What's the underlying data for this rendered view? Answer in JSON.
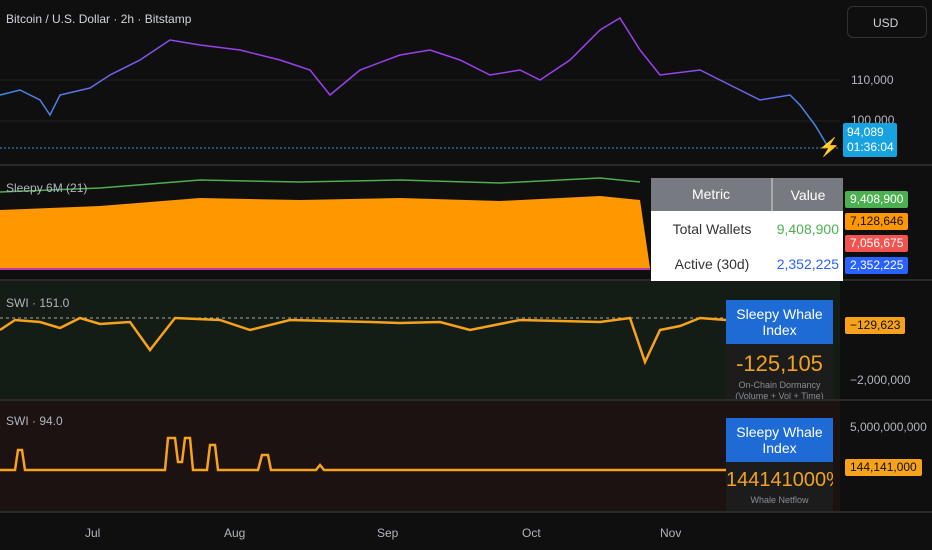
{
  "header": {
    "symbol_title": "Bitcoin / U.S. Dollar · 2h · Bitstamp",
    "currency_button": "USD"
  },
  "price_axis": {
    "labels": [
      "110,000",
      "100,000"
    ],
    "last_price": "94,089",
    "countdown": "01:36:04"
  },
  "pane2": {
    "title": "Sleepy 6M (21)",
    "tags": [
      {
        "v": "9,408,900",
        "c": "#4caf50"
      },
      {
        "v": "7,128,646",
        "c": "#ff9800"
      },
      {
        "v": "7,056,675",
        "c": "#f05350"
      },
      {
        "v": "2,352,225",
        "c": "#2962ff"
      }
    ],
    "table": {
      "headers": [
        "Metric",
        "Value"
      ],
      "rows": [
        {
          "metric": "Total Wallets",
          "value": "9,408,900",
          "color": "#4caf50"
        },
        {
          "metric": "Active (30d)",
          "value": "2,352,225",
          "color": "#2962ff"
        }
      ]
    }
  },
  "pane3": {
    "title": "SWI · 151.0",
    "box_title": "Sleepy Whale Index",
    "box_value": "-125,105",
    "box_sub1": "On-Chain Dormancy",
    "box_sub2": "(Volume + Vol + Time)",
    "tag": "−129,623",
    "axis_label": "−2,000,000"
  },
  "pane4": {
    "title": "SWI · 94.0",
    "box_title": "Sleepy Whale Index",
    "box_value": "144141000%",
    "box_sub": "Whale Netflow",
    "tag": "144,141,000",
    "axis_label": "5,000,000,000"
  },
  "time_axis": [
    "Jul",
    "Aug",
    "Sep",
    "Oct",
    "Nov"
  ],
  "series": {
    "price": [
      [
        0,
        95
      ],
      [
        20,
        90
      ],
      [
        40,
        100
      ],
      [
        50,
        115
      ],
      [
        60,
        95
      ],
      [
        90,
        88
      ],
      [
        110,
        75
      ],
      [
        140,
        60
      ],
      [
        170,
        40
      ],
      [
        200,
        45
      ],
      [
        240,
        50
      ],
      [
        280,
        60
      ],
      [
        310,
        70
      ],
      [
        330,
        95
      ],
      [
        360,
        70
      ],
      [
        400,
        55
      ],
      [
        430,
        50
      ],
      [
        460,
        60
      ],
      [
        490,
        75
      ],
      [
        520,
        70
      ],
      [
        540,
        80
      ],
      [
        570,
        60
      ],
      [
        600,
        30
      ],
      [
        620,
        18
      ],
      [
        640,
        50
      ],
      [
        660,
        75
      ],
      [
        700,
        70
      ],
      [
        730,
        85
      ],
      [
        760,
        100
      ],
      [
        790,
        95
      ],
      [
        800,
        105
      ],
      [
        815,
        125
      ],
      [
        830,
        150
      ]
    ],
    "sleepy": [
      [
        0,
        192
      ],
      [
        50,
        190
      ],
      [
        100,
        188
      ],
      [
        150,
        184
      ],
      [
        200,
        180
      ],
      [
        300,
        182
      ],
      [
        400,
        180
      ],
      [
        500,
        183
      ],
      [
        600,
        178
      ],
      [
        640,
        182
      ]
    ],
    "swi": [
      [
        0,
        330
      ],
      [
        15,
        320
      ],
      [
        40,
        322
      ],
      [
        60,
        328
      ],
      [
        80,
        318
      ],
      [
        100,
        324
      ],
      [
        130,
        322
      ],
      [
        150,
        350
      ],
      [
        175,
        318
      ],
      [
        220,
        320
      ],
      [
        250,
        330
      ],
      [
        290,
        320
      ],
      [
        370,
        322
      ],
      [
        400,
        323
      ],
      [
        440,
        322
      ],
      [
        470,
        330
      ],
      [
        520,
        320
      ],
      [
        600,
        322
      ],
      [
        630,
        318
      ],
      [
        645,
        362
      ],
      [
        660,
        330
      ],
      [
        680,
        326
      ],
      [
        700,
        318
      ],
      [
        726,
        320
      ]
    ],
    "netflow": [
      [
        0,
        470
      ],
      [
        15,
        470
      ],
      [
        18,
        450
      ],
      [
        22,
        450
      ],
      [
        25,
        470
      ],
      [
        165,
        470
      ],
      [
        168,
        438
      ],
      [
        175,
        438
      ],
      [
        178,
        462
      ],
      [
        182,
        462
      ],
      [
        185,
        438
      ],
      [
        190,
        438
      ],
      [
        193,
        470
      ],
      [
        207,
        470
      ],
      [
        210,
        445
      ],
      [
        215,
        445
      ],
      [
        218,
        470
      ],
      [
        258,
        470
      ],
      [
        262,
        455
      ],
      [
        268,
        455
      ],
      [
        271,
        470
      ],
      [
        316,
        470
      ],
      [
        320,
        465
      ],
      [
        324,
        470
      ],
      [
        726,
        470
      ]
    ]
  },
  "colors": {
    "accent": "#f7a21b",
    "price_start": "#3d8ee8",
    "price_end": "#9c3ff0"
  }
}
